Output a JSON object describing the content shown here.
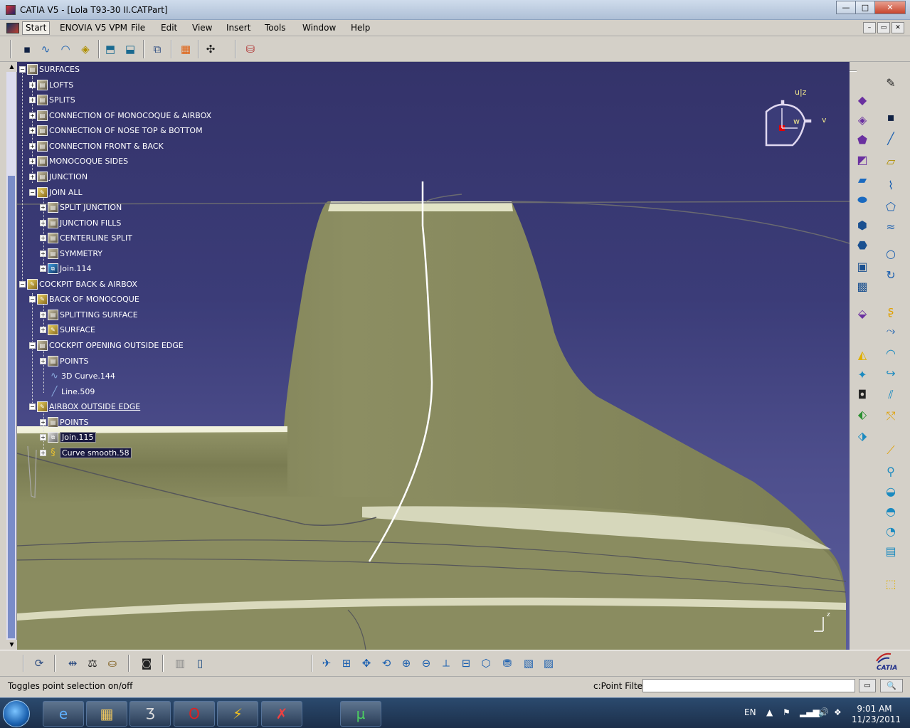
{
  "window": {
    "title": "CATIA V5 - [Lola T93-30 II.CATPart]",
    "buttons": {
      "minimize": "—",
      "maximize": "□",
      "close": "✕"
    }
  },
  "menubar": {
    "items": [
      "Start",
      "ENOVIA V5 VPM",
      "File",
      "Edit",
      "View",
      "Insert",
      "Tools",
      "Window",
      "Help"
    ],
    "mdi_buttons": [
      "–",
      "▭",
      "✕"
    ]
  },
  "tree": {
    "nodes": [
      {
        "label": "SURFACES",
        "icon": "geometrical-set-icon"
      },
      {
        "label": "LOFTS",
        "icon": "geometrical-set-icon"
      },
      {
        "label": "SPLITS",
        "icon": "geometrical-set-icon"
      },
      {
        "label": "CONNECTION OF MONOCOQUE & AIRBOX",
        "icon": "geometrical-set-icon"
      },
      {
        "label": "CONNECTION OF NOSE TOP & BOTTOM",
        "icon": "geometrical-set-icon"
      },
      {
        "label": "CONNECTION FRONT & BACK",
        "icon": "geometrical-set-icon"
      },
      {
        "label": "MONOCOQUE SIDES",
        "icon": "geometrical-set-icon"
      },
      {
        "label": "JUNCTION",
        "icon": "geometrical-set-icon"
      },
      {
        "label": "JOIN ALL",
        "icon": "join-set-icon"
      },
      {
        "label": "SPLIT JUNCTION",
        "icon": "geometrical-set-icon"
      },
      {
        "label": "JUNCTION FILLS",
        "icon": "geometrical-set-icon"
      },
      {
        "label": "CENTERLINE SPLIT",
        "icon": "geometrical-set-icon"
      },
      {
        "label": "SYMMETRY",
        "icon": "geometrical-set-icon"
      },
      {
        "label": "Join.114",
        "icon": "join-icon"
      },
      {
        "label": "COCKPIT BACK & AIRBOX",
        "icon": "join-set-icon"
      },
      {
        "label": "BACK OF MONOCOQUE",
        "icon": "join-set-icon"
      },
      {
        "label": "SPLITTING SURFACE",
        "icon": "geometrical-set-icon"
      },
      {
        "label": "SURFACE",
        "icon": "join-set-icon"
      },
      {
        "label": "COCKPIT OPENING OUTSIDE EDGE",
        "icon": "geometrical-set-icon"
      },
      {
        "label": "POINTS",
        "icon": "geometrical-set-icon"
      },
      {
        "label": "3D Curve.144",
        "icon": "curve-icon"
      },
      {
        "label": "Line.509",
        "icon": "line-icon"
      },
      {
        "label": "AIRBOX OUTSIDE EDGE",
        "icon": "join-set-icon"
      },
      {
        "label": "POINTS",
        "icon": "geometrical-set-icon"
      },
      {
        "label": "Join.115",
        "icon": "join-icon"
      },
      {
        "label": "Curve smooth.58",
        "icon": "curve-smooth-icon"
      }
    ]
  },
  "compass": {
    "u": "u|z",
    "w": "w",
    "v": "v"
  },
  "axis": {
    "z": "z"
  },
  "status": {
    "message": "Toggles point selection on/off",
    "filter_label": "c:Point Filter",
    "command_value": ""
  },
  "brand": {
    "catia": "CATIA"
  },
  "taskbar": {
    "lang": "EN",
    "time": "9:01 AM",
    "date": "11/23/2011"
  },
  "colors": {
    "viewport_bg": "#3b3c78",
    "surface": "#8a8a60",
    "tree_text": "#ffffff"
  }
}
